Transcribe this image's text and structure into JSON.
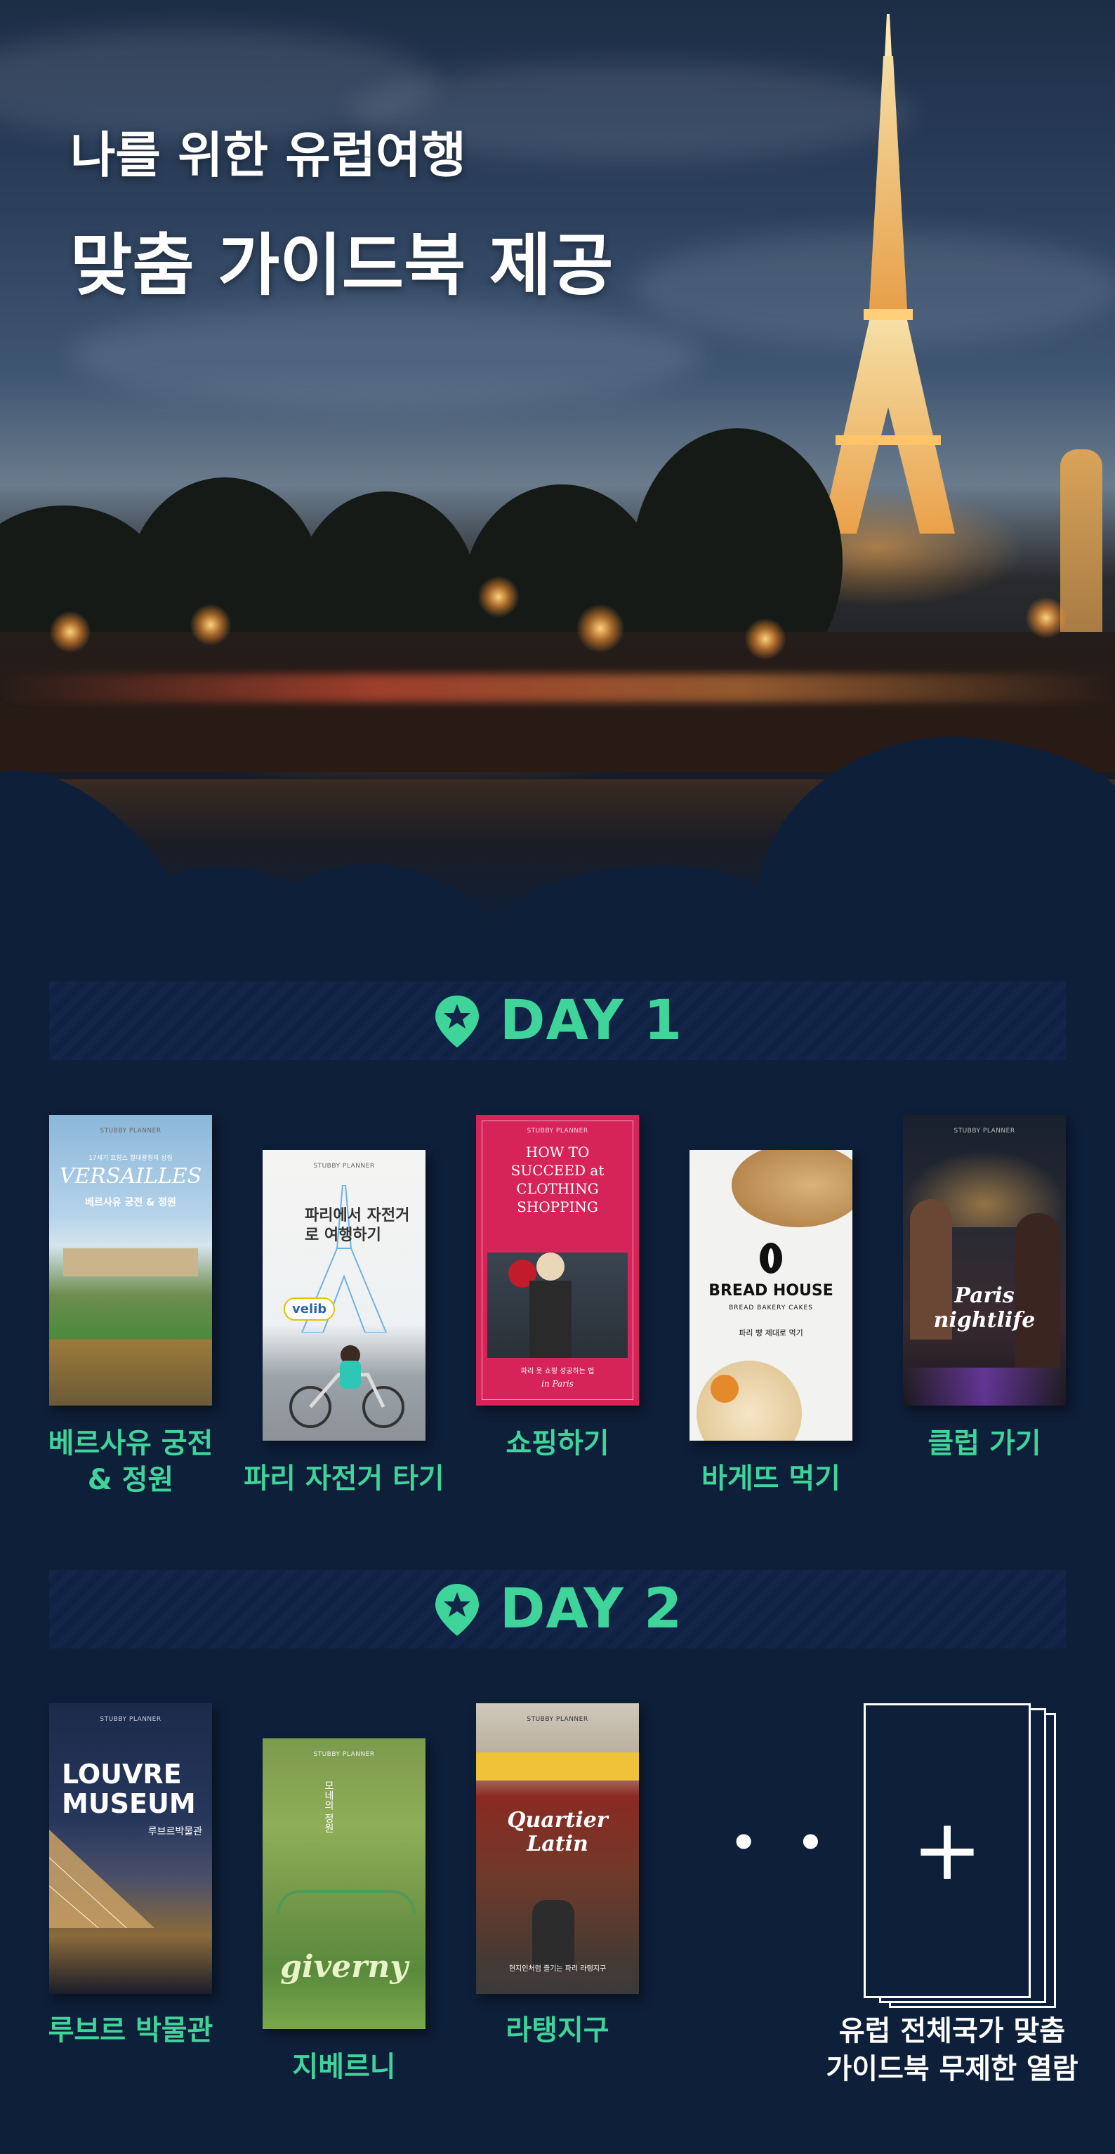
{
  "hero": {
    "line1": "나를 위한 유럽여행",
    "line2": "맞춤 가이드북 제공"
  },
  "colors": {
    "accent": "#3fd49a",
    "background": "#0e1f3a",
    "banner": "#13264a"
  },
  "day1": {
    "title": "DAY 1",
    "icon": "map-pin-star-icon",
    "books": [
      {
        "caption": "베르사유 궁전\n& 정원",
        "cover_publisher": "STUBBY PLANNER",
        "cover_title": "VERSAILLES",
        "cover_subtitle": "베르사유 궁전 & 정원",
        "cover_tag": "17세기 프랑스 절대왕정의 상징"
      },
      {
        "caption": "파리 자전거 타기",
        "cover_publisher": "STUBBY PLANNER",
        "cover_title": "파리에서 자전거로 여행하기",
        "cover_tag": "velib"
      },
      {
        "caption": "쇼핑하기",
        "cover_publisher": "STUBBY PLANNER",
        "cover_title": "HOW TO SUCCEED at CLOTHING SHOPPING",
        "cover_subtitle": "파리 옷 쇼핑 성공하는 법",
        "cover_tag": "in Paris"
      },
      {
        "caption": "바게뜨 먹기",
        "cover_publisher": "",
        "cover_title": "BREAD HOUSE",
        "cover_subtitle": "BREAD BAKERY CAKES",
        "cover_tag": "파리 빵 제대로 먹기"
      },
      {
        "caption": "클럽 가기",
        "cover_publisher": "STUBBY PLANNER",
        "cover_title": "Paris nightlife",
        "cover_tag": ""
      }
    ]
  },
  "day2": {
    "title": "DAY 2",
    "icon": "map-pin-star-icon",
    "books": [
      {
        "caption": "루브르 박물관",
        "cover_publisher": "STUBBY PLANNER",
        "cover_title": "LOUVRE MUSEUM",
        "cover_subtitle": "루브르박물관"
      },
      {
        "caption": "지베르니",
        "cover_publisher": "STUBBY PLANNER",
        "cover_title": "giverny",
        "cover_subtitle": "모네의 정원"
      },
      {
        "caption": "라탱지구",
        "cover_publisher": "STUBBY PLANNER",
        "cover_title": "Quartier Latin",
        "cover_subtitle": "현지인처럼 즐기는 파리 라탱지구"
      }
    ],
    "more": "• • •",
    "final_caption": "유럽 전체국가 맞춤\n가이드북 무제한 열람",
    "plus": "+"
  }
}
